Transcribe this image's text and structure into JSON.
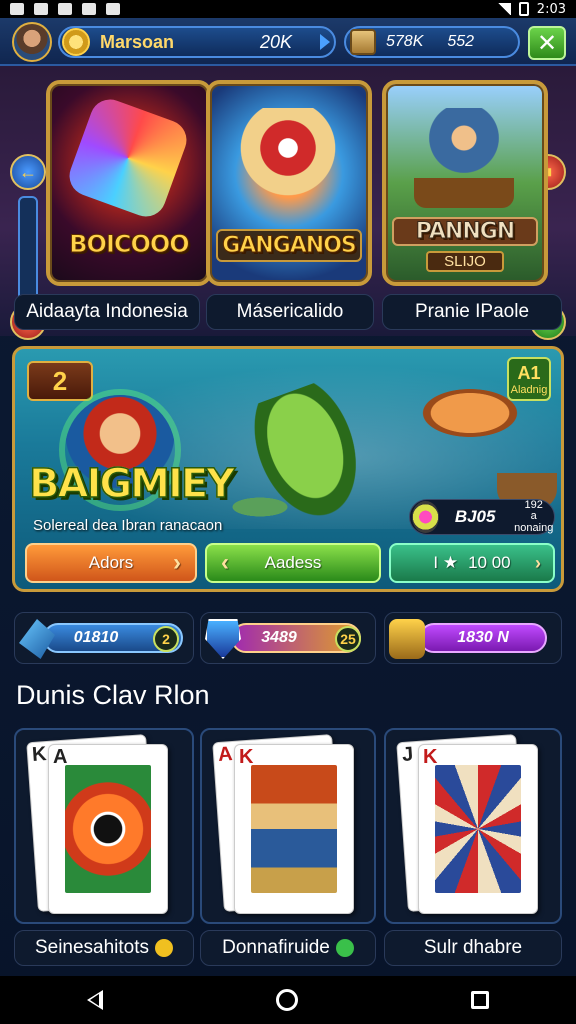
{
  "status_bar": {
    "time": "2:03"
  },
  "top_bar": {
    "gold_name": "Marsoan",
    "gold_value": "20K",
    "cash_value": "578K",
    "cash_value_2": "552",
    "close_symbol": "✕"
  },
  "featured": [
    {
      "title": "BOICOOO",
      "subtitle": "",
      "label": "Aidaayta Indonesia"
    },
    {
      "title": "GANGANOS",
      "subtitle": "",
      "label": "Másericalido"
    },
    {
      "title": "PANNGN",
      "subtitle": "SLIJO",
      "label": "Pranie IPaole"
    }
  ],
  "banner": {
    "badge": "2",
    "corner_top": "A1",
    "corner_bottom": "Aladnig",
    "title": "BAIGMIEY",
    "description": "Solereal dea Ibran ranacaon",
    "balance_value": "BJ05",
    "balance_side_1": "192",
    "balance_side_2": "a nonaing",
    "buttons": [
      {
        "label": "Adors",
        "chevron": "›"
      },
      {
        "label": "Aadess",
        "chevron": "‹"
      },
      {
        "label": "10 00",
        "prefix": "I ★",
        "chevron": "›"
      }
    ]
  },
  "currencies": [
    {
      "value": "01810",
      "add": "2"
    },
    {
      "value": "3489",
      "add": "25"
    },
    {
      "value": "1830 N",
      "add": ""
    }
  ],
  "section": {
    "title": "Dunis Clav Rlon",
    "cards": [
      {
        "rank_back": "K",
        "rank_front": "A",
        "label": "Seinesahitots",
        "dot": "yellow"
      },
      {
        "rank_back": "A",
        "rank_front": "K",
        "label": "Donnafiruide",
        "dot": "green"
      },
      {
        "rank_back": "J",
        "rank_front": "K",
        "label": "Sulr dhabre",
        "dot": ""
      }
    ]
  },
  "icons": {
    "gold": "coin-icon",
    "cash": "scroll-icon",
    "close": "close-icon",
    "balance": "gem-icon",
    "currency_1": "blue-crystal-icon",
    "currency_2": "shield-icon",
    "currency_3": "barrel-icon"
  }
}
